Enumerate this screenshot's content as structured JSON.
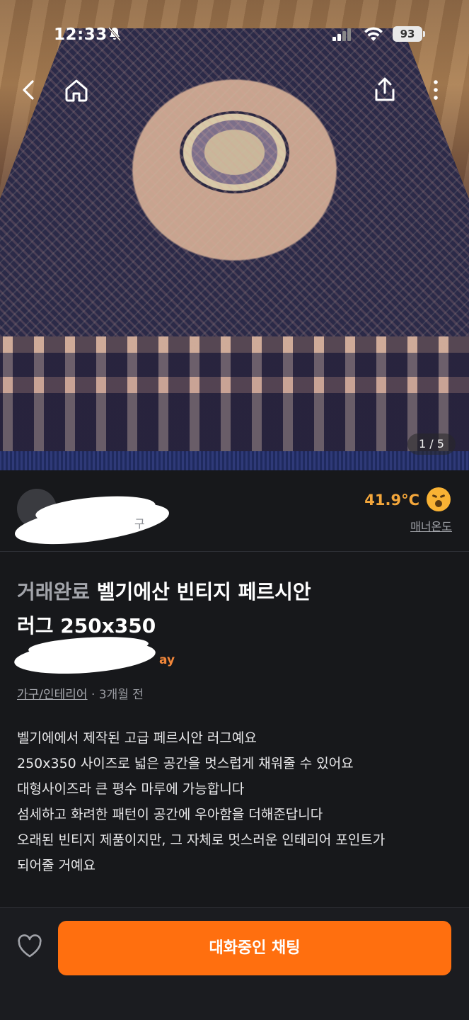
{
  "status_bar": {
    "time": "12:33",
    "battery": "93"
  },
  "photo": {
    "counter": "1 / 5"
  },
  "seller": {
    "location": "구",
    "temperature": "41.9°C",
    "manner_label": "매너온도"
  },
  "listing": {
    "status": "거래완료",
    "title_line1": "벨기에산 빈티지 페르시안",
    "title_line2": "러그 250x350",
    "pay_label": "ay",
    "category": "가구/인테리어",
    "time_ago": "· 3개월 전",
    "description": [
      "벨기에에서 제작된 고급 페르시안 러그예요",
      "250x350 사이즈로 넓은 공간을 멋스럽게 채워줄 수 있어요",
      "대형사이즈라 큰 평수 마루에 가능합니다",
      "섬세하고 화려한 패턴이 공간에 우아함을 더해준답니다",
      "오래된 빈티지 제품이지만, 그 자체로 멋스러운 인테리어 포인트가",
      "되어줄 거예요"
    ]
  },
  "bottom_bar": {
    "chat_button": "대화중인 채팅"
  },
  "colors": {
    "accent": "#ff6f0f",
    "temperature": "#f3a63b",
    "background": "#17181b"
  },
  "icons": [
    "back-icon",
    "home-icon",
    "share-icon",
    "more-icon",
    "heart-icon",
    "bell-slash-icon",
    "signal-icon",
    "wifi-icon"
  ]
}
